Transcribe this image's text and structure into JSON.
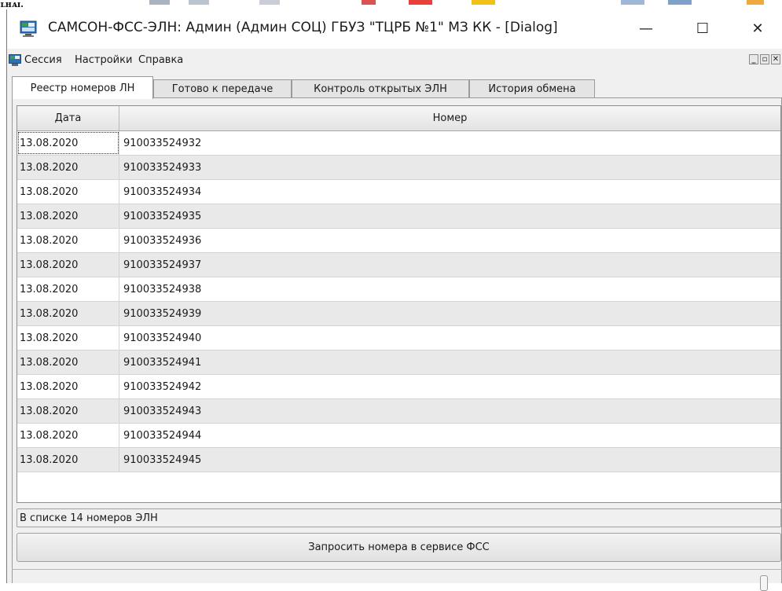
{
  "window": {
    "title": "САМСОН-ФСС-ЭЛН: Админ (Админ СОЦ) ГБУЗ \"ТЦРБ №1\" МЗ КК - [Dialog]",
    "minimize_glyph": "—",
    "maximize_glyph": "☐",
    "close_glyph": "✕"
  },
  "menubar": {
    "items": [
      "Сессия",
      "Настройки",
      "Справка"
    ],
    "mdi_minimize": "_",
    "mdi_restore": "▫",
    "mdi_close": "✕"
  },
  "tabs": [
    {
      "label": "Реестр номеров ЛН",
      "active": true
    },
    {
      "label": "Готово к передаче",
      "active": false
    },
    {
      "label": "Контроль открытых ЭЛН",
      "active": false
    },
    {
      "label": "История обмена",
      "active": false
    }
  ],
  "table": {
    "columns": [
      "Дата",
      "Номер"
    ],
    "rows": [
      [
        "13.08.2020",
        "910033524932"
      ],
      [
        "13.08.2020",
        "910033524933"
      ],
      [
        "13.08.2020",
        "910033524934"
      ],
      [
        "13.08.2020",
        "910033524935"
      ],
      [
        "13.08.2020",
        "910033524936"
      ],
      [
        "13.08.2020",
        "910033524937"
      ],
      [
        "13.08.2020",
        "910033524938"
      ],
      [
        "13.08.2020",
        "910033524939"
      ],
      [
        "13.08.2020",
        "910033524940"
      ],
      [
        "13.08.2020",
        "910033524941"
      ],
      [
        "13.08.2020",
        "910033524942"
      ],
      [
        "13.08.2020",
        "910033524943"
      ],
      [
        "13.08.2020",
        "910033524944"
      ],
      [
        "13.08.2020",
        "910033524945"
      ]
    ]
  },
  "status": {
    "count_text": "В списке 14 номеров ЭЛН"
  },
  "actions": {
    "request_label": "Запросить номера в сервисе ФСС"
  },
  "colors": {
    "window_bg": "#f0f0f0",
    "row_alt": "#e9e9e9",
    "app_icon_blue": "#2f6fb3",
    "app_icon_green": "#3aa04a"
  }
}
